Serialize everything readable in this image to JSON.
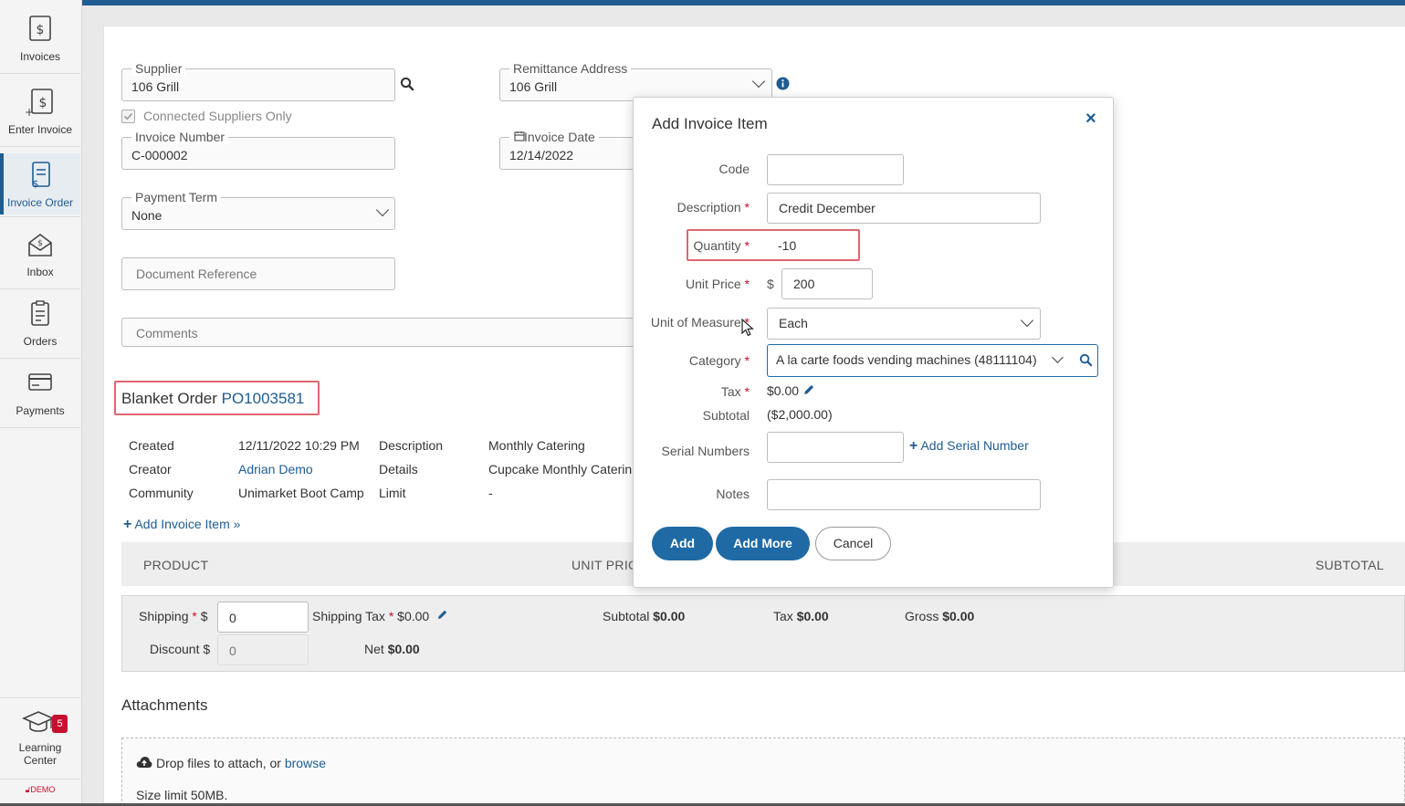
{
  "sidebar": {
    "items": [
      {
        "label": "Invoices",
        "icon": "invoice-dollar-icon"
      },
      {
        "label": "Enter Invoice",
        "icon": "invoice-add-icon"
      },
      {
        "label": "Invoice Order",
        "icon": "invoice-order-icon"
      },
      {
        "label": "Inbox",
        "icon": "inbox-icon"
      },
      {
        "label": "Orders",
        "icon": "orders-icon"
      },
      {
        "label": "Payments",
        "icon": "payments-icon"
      }
    ],
    "learning_center": {
      "label_1": "Learning",
      "label_2": "Center",
      "badge": "5"
    },
    "demo_label": "DEMO"
  },
  "form": {
    "supplier": {
      "label": "Supplier",
      "value": "106 Grill"
    },
    "connected_only": {
      "label": "Connected Suppliers Only",
      "checked": true
    },
    "remittance": {
      "label": "Remittance Address",
      "value": "106 Grill"
    },
    "invoice_number": {
      "label": "Invoice Number",
      "value": "C-000002"
    },
    "invoice_date": {
      "label": "Invoice Date",
      "value": "12/14/2022"
    },
    "payment_term": {
      "label": "Payment Term",
      "value": "None"
    },
    "document_reference": {
      "placeholder": "Document Reference"
    },
    "comments": {
      "placeholder": "Comments"
    }
  },
  "blanket_order": {
    "prefix": "Blanket Order",
    "number": "PO1003581",
    "created_label": "Created",
    "created_value": "12/11/2022 10:29 PM",
    "creator_label": "Creator",
    "creator_value": "Adrian Demo",
    "community_label": "Community",
    "community_value": "Unimarket Boot Camp",
    "description_label": "Description",
    "description_value": "Monthly Catering",
    "details_label": "Details",
    "details_value": "Cupcake Monthly Caterin",
    "limit_label": "Limit",
    "limit_value": "-",
    "add_item_link": "Add Invoice Item »"
  },
  "table": {
    "headers": {
      "product": "PRODUCT",
      "unit_price": "UNIT PRIC",
      "subtotal": "SUBTOTAL"
    }
  },
  "totals": {
    "shipping_label": "Shipping",
    "shipping_currency": "$",
    "shipping_value": "0",
    "shipping_tax_label": "Shipping Tax",
    "shipping_tax_value": "$0.00",
    "subtotal_label": "Subtotal",
    "subtotal_value": "$0.00",
    "tax_label": "Tax",
    "tax_value": "$0.00",
    "gross_label": "Gross",
    "gross_value": "$0.00",
    "discount_label": "Discount $",
    "discount_value": "0",
    "net_label": "Net",
    "net_value": "$0.00"
  },
  "attachments": {
    "title": "Attachments",
    "drop_text": "Drop files to attach, or",
    "browse": "browse",
    "size_limit": "Size limit 50MB."
  },
  "modal": {
    "title": "Add Invoice Item",
    "code_label": "Code",
    "code_value": "",
    "description_label": "Description",
    "description_value": "Credit December",
    "quantity_label": "Quantity",
    "quantity_value": "-10",
    "unit_price_label": "Unit Price",
    "unit_price_currency": "$",
    "unit_price_value": "200",
    "uom_label": "Unit of Measure",
    "uom_value": "Each",
    "category_label": "Category",
    "category_value": "A la carte foods vending machines (48111104)",
    "tax_label": "Tax",
    "tax_value": "$0.00",
    "subtotal_label": "Subtotal",
    "subtotal_value": "($2,000.00)",
    "serial_label": "Serial Numbers",
    "add_serial": "Add Serial Number",
    "notes_label": "Notes",
    "add_button": "Add",
    "add_more_button": "Add More",
    "cancel_button": "Cancel",
    "required_mark": "*"
  },
  "colors": {
    "brand": "#1f5c92",
    "required": "#c8102e",
    "highlight": "#e06670"
  }
}
